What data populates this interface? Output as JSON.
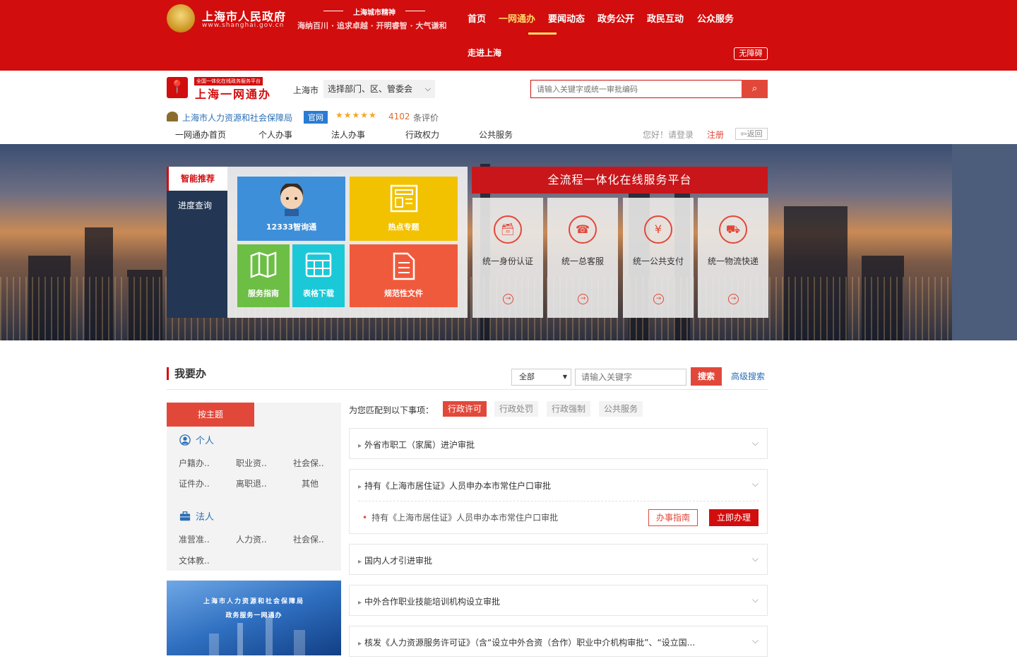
{
  "gov_header": {
    "name": "上海市人民政府",
    "url": "www.shanghai.gov.cn",
    "spirit_title": "上海城市精神",
    "spirit_text": "海纳百川 · 追求卓越 · 开明睿智 · 大气谦和",
    "nav": [
      "首页",
      "一网通办",
      "要闻动态",
      "政务公开",
      "政民互动",
      "公众服务"
    ],
    "nav_second": "走进上海",
    "barrier_free": "无障碍"
  },
  "ywb_header": {
    "tag": "全国一体化在线政务服务平台",
    "title": "上海一网通办",
    "city": "上海市",
    "dept_select": "选择部门、区、管委会",
    "search_placeholder": "请输入关键字或统一审批编码"
  },
  "bureau": {
    "name": "上海市人力资源和社会保障局",
    "badge": "官网",
    "stars": "★★★★★",
    "review_count": "4102",
    "review_suffix": "条评价"
  },
  "subnav": [
    "一网通办首页",
    "个人办事",
    "法人办事",
    "行政权力",
    "公共服务"
  ],
  "user": {
    "greeting": "您好！请登录",
    "register": "注册",
    "back": "返回"
  },
  "banner": {
    "tab_smart": "智能推荐",
    "tab_progress": "进度查询",
    "tiles": {
      "hotline": "12333智询通",
      "topics": "热点专题",
      "guide": "服务指南",
      "forms": "表格下载",
      "docs": "规范性文件"
    },
    "platform_title": "全流程一体化在线服务平台",
    "services": [
      "统一身份认证",
      "统一总客服",
      "统一公共支付",
      "统一物流快递"
    ]
  },
  "wyb": {
    "title": "我要办",
    "scope": "全部",
    "kw_placeholder": "请输入关键字",
    "search_btn": "搜索",
    "adv_search": "高级搜索",
    "theme_tab": "按主题",
    "personal": {
      "label": "个人",
      "cats": [
        "户籍办..",
        "职业资..",
        "社会保..",
        "证件办..",
        "离职退..",
        "其他"
      ]
    },
    "corporate": {
      "label": "法人",
      "cats": [
        "准营准..",
        "人力资..",
        "社会保..",
        "文体教.."
      ]
    },
    "promo_title": "上海市人力资源和社会保障局",
    "promo_sub": "政务服务一网通办",
    "match_label": "为您匹配到以下事项：",
    "filters": [
      "行政许可",
      "行政处罚",
      "行政强制",
      "公共服务"
    ],
    "items": [
      "外省市职工（家属）进沪审批",
      "持有《上海市居住证》人员申办本市常住户口审批",
      "国内人才引进审批",
      "中外合作职业技能培训机构设立审批",
      "核发《人力资源服务许可证》（含“设立中外合资（合作）职业中介机构审批”、“设立国..."
    ],
    "sub_item": "持有《上海市居住证》人员申办本市常住户口审批",
    "guide_btn": "办事指南",
    "apply_btn": "立即办理"
  }
}
